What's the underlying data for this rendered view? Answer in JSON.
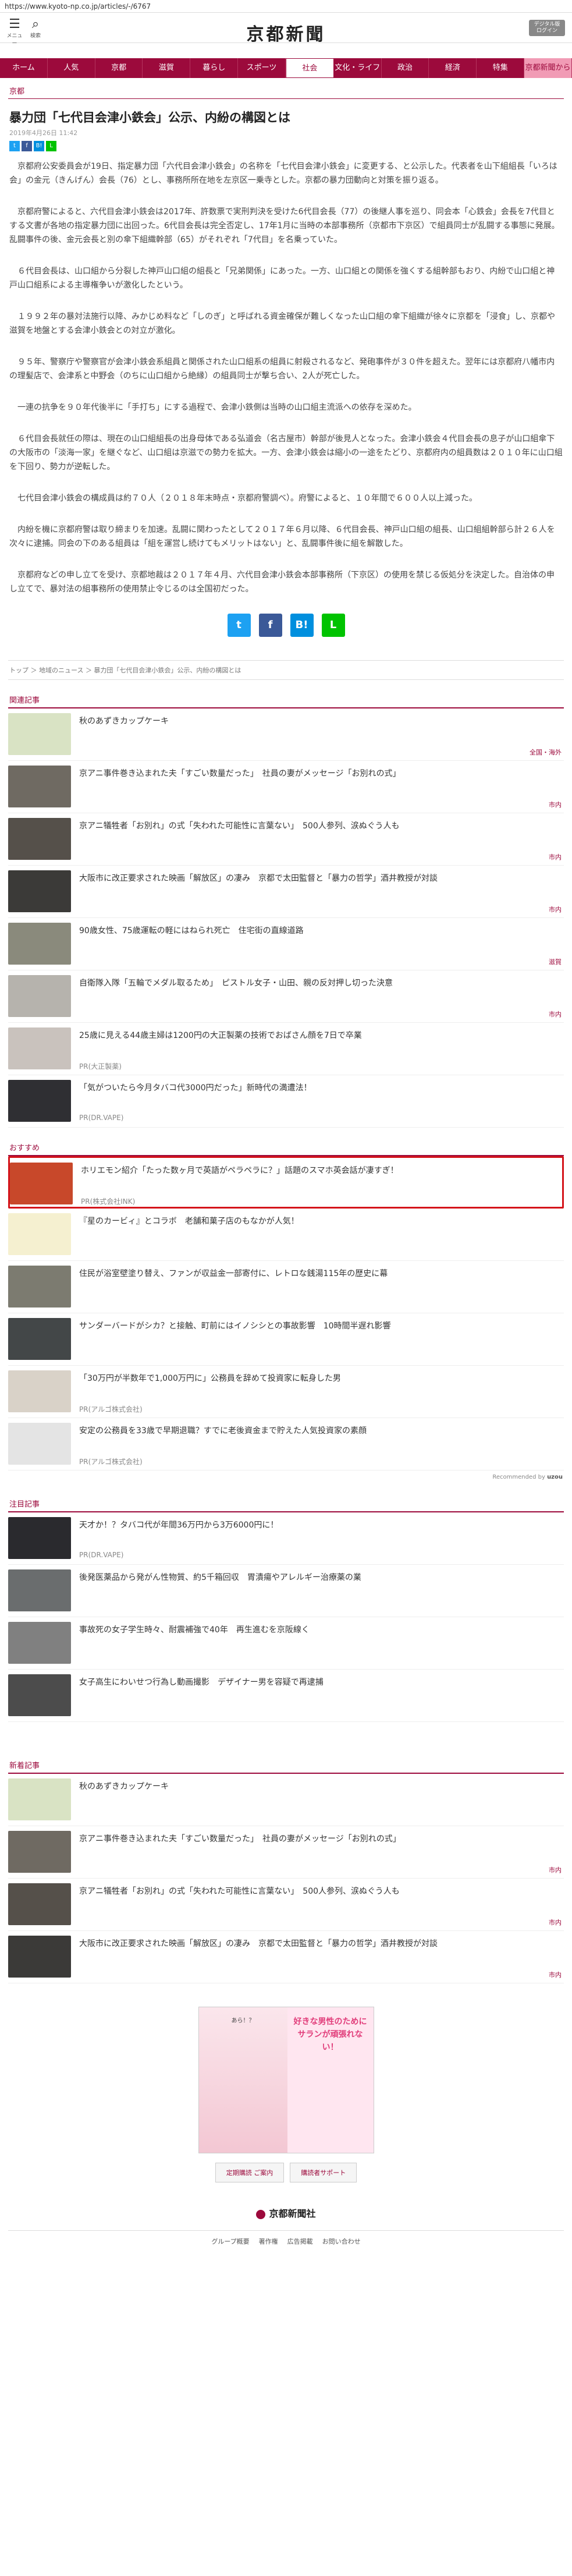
{
  "url": "https://www.kyoto-np.co.jp/articles/-/6767",
  "header": {
    "menu_label": "メニュー",
    "search_label": "検索",
    "logo": "京都新聞",
    "digital_label": "デジタル版\nログイン"
  },
  "nav": [
    "ホーム",
    "人気",
    "京都",
    "滋賀",
    "暮らし",
    "スポーツ",
    "社会",
    "文化・ライフ",
    "政治",
    "経済",
    "特集",
    "京都新聞から"
  ],
  "nav_active": "社会",
  "section": "京都",
  "article": {
    "title": "暴力団「七代目会津小鉄会」公示、内紛の構図とは",
    "date": "2019年4月26日 11:42",
    "paragraphs": [
      "京都府公安委員会が19日、指定暴力団「六代目会津小鉄会」の名称を「七代目会津小鉄会」に変更する、と公示した。代表者を山下組組長「いろは会」の金元（きんげん）会長（76）とし、事務所所在地を左京区一乗寺とした。京都の暴力団動向と対策を振り返る。",
      "京都府警によると、六代目会津小鉄会は2017年、許数票で実刑判決を受けた6代目会長（77）の後継人事を巡り、同会本「心鉄会」会長を7代目とする文書が各地の指定暴力団に出回った。6代目会長は完全否定し、17年1月に当時の本部事務所（京都市下京区）で組員同士が乱闘する事態に発展。乱闘事件の後、金元会長と別の傘下組織幹部（65）がそれぞれ「7代目」を名乗っていた。",
      "６代目会長は、山口組から分裂した神戸山口組の組長と「兄弟関係」にあった。一方、山口組との関係を強くする組幹部もおり、内紛で山口組と神戸山口組系による主導権争いが激化したという。",
      "１９９２年の暴対法施行以降、みかじめ料など「しのぎ」と呼ばれる資金確保が難しくなった山口組の傘下組織が徐々に京都を「浸食」し、京都や滋賀を地盤とする会津小鉄会との対立が激化。",
      "９５年、警察庁や警察官が会津小鉄会系組員と関係された山口組系の組員に射殺されるなど、発砲事件が３０件を超えた。翌年には京都府八幡市内の理髪店で、会津系と中野会（のちに山口組から絶縁）の組員同士が撃ち合い、2人が死亡した。",
      "一連の抗争を９０年代後半に「手打ち」にする過程で、会津小鉄側は当時の山口組主流派への依存を深めた。",
      "６代目会長就任の際は、現在の山口組組長の出身母体である弘道会（名古屋市）幹部が後見人となった。会津小鉄会４代目会長の息子が山口組傘下の大阪市の「淡海一家」を継ぐなど、山口組は京滋での勢力を拡大。一方、会津小鉄会は縮小の一途をたどり、京都府内の組員数は２０１０年に山口組を下回り、勢力が逆転した。",
      "七代目会津小鉄会の構成員は約７０人（２０１８年末時点・京都府警調べ）。府警によると、１０年間で６００人以上減った。",
      "内紛を機に京都府警は取り締まりを加速。乱闘に関わったとして２０１７年６月以降、６代目会長、神戸山口組の組長、山口組組幹部ら計２６人を次々に逮捕。同会の下のある組員は「組を運営し続けてもメリットはない」と、乱闘事件後に組を解散した。",
      "京都府などの申し立てを受け、京都地裁は２０１７年４月、六代目会津小鉄会本部事務所（下京区）の使用を禁じる仮処分を決定した。自治体の申し立てで、暴対法の組事務所の使用禁止令じるのは全国初だった。"
    ]
  },
  "share_small": [
    "Twitter",
    "Facebook",
    "Hatena",
    "LINE"
  ],
  "share_big": [
    "Twitter",
    "Facebook",
    "Hatena",
    "LINE"
  ],
  "breadcrumb": "トップ  ＞  地域のニュース  ＞  暴力団「七代目会津小鉄会」公示、内紛の構図とは",
  "related": {
    "label": "関連記事",
    "items": [
      {
        "title": "秋のあずきカップケーキ",
        "tag": "全国・海外",
        "thumb": "#d9e3c4"
      },
      {
        "title": "京アニ事件巻き込まれた夫「すごい数量だった」　社員の妻がメッセージ「お別れの式」",
        "tag": "市内",
        "thumb": "#6f6a62"
      },
      {
        "title": "京アニ犠牲者「お別れ」の式「失われた可能性に言葉ない」　500人参列、涙ぬぐう人も",
        "tag": "市内",
        "thumb": "#55504a"
      },
      {
        "title": "大阪市に改正要求された映画「解放区」の凄み　京都で太田監督と「暴力の哲学」酒井教授が対談",
        "tag": "市内",
        "thumb": "#3b3a38"
      },
      {
        "title": "90歳女性、75歳運転の軽にはねられ死亡　住宅街の直線道路",
        "tag": "滋賀",
        "thumb": "#8a8a7c"
      },
      {
        "title": "自衛隊入隊「五輪でメダル取るため」　ピストル女子・山田、親の反対押し切った決意",
        "tag": "市内",
        "thumb": "#b6b3ad"
      },
      {
        "title": "25歳に見える44歳主婦は1200円の大正製薬の技術でおばさん顔を7日で卒業",
        "pr": "PR(大正製薬)",
        "thumb": "#c9c2bd"
      },
      {
        "title": "「気がついたら今月タバコ代3000円だった」新時代の満遭法！",
        "pr": "PR(DR.VAPE)",
        "thumb": "#2f2f33"
      }
    ]
  },
  "recommend": {
    "label": "おすすめ",
    "items": [
      {
        "title": "ホリエモン紹介「たった数ヶ月で英語がペラペラに？」話題のスマホ英会話が凄すぎ！",
        "pr": "PR(株式会社INK)",
        "thumb": "#c8482a",
        "highlight": true
      },
      {
        "title": "『星のカービィ』とコラボ　老舗和菓子店のもなかが人気！",
        "thumb": "#f5f0d0"
      },
      {
        "title": "住民が浴室壁塗り替え、ファンが収益金一部寄付に、レトロな銭湯115年の歴史に幕",
        "thumb": "#7c7b70"
      },
      {
        "title": "サンダーバードがシカ？と接触、町前にはイノシシとの事故影響　10時間半遅れ影響",
        "thumb": "#434748"
      },
      {
        "title": "「30万円が半数年で1,000万円に」公務員を辞めて投資家に転身した男",
        "pr": "PR(アルゴ株式会社)",
        "thumb": "#d9d2c8"
      },
      {
        "title": "安定の公務員を33歳で早期退職？すでに老後資金まで貯えた人気投資家の素顔",
        "pr": "PR(アルゴ株式会社)",
        "thumb": "#e4e4e4"
      }
    ],
    "footer": "Recommended by",
    "footer_brand": "uzou"
  },
  "attention": {
    "label": "注目記事",
    "items": [
      {
        "title": "天才か！？タバコ代が年間36万円から3万6000円に！",
        "pr": "PR(DR.VAPE)",
        "thumb": "#2a2a2e"
      },
      {
        "title": "後発医薬品から発がん性物質、約5千箱回収　胃潰瘍やアレルギー治療薬の業",
        "thumb": "#6a6d6e"
      },
      {
        "title": "事故死の女子学生時々、耐震補強で40年　再生進むを京阪線く",
        "thumb": "#808080"
      },
      {
        "title": "女子高生にわいせつ行為し動画撮影　デザイナー男を容疑で再逮捕",
        "thumb": "#4c4c4c"
      }
    ]
  },
  "newest": {
    "label": "新着記事",
    "items": [
      {
        "title": "秋のあずきカップケーキ",
        "thumb": "#d9e3c4"
      },
      {
        "title": "京アニ事件巻き込まれた夫「すごい数量だった」　社員の妻がメッセージ「お別れの式」",
        "tag": "市内",
        "thumb": "#6f6a62"
      },
      {
        "title": "京アニ犠牲者「お別れ」の式「失われた可能性に言葉ない」　500人参列、涙ぬぐう人も",
        "tag": "市内",
        "thumb": "#55504a"
      },
      {
        "title": "大阪市に改正要求された映画「解放区」の凄み　京都で太田監督と「暴力の哲学」酒井教授が対談",
        "tag": "市内",
        "thumb": "#3b3a38"
      }
    ]
  },
  "ad": {
    "left_text": "あら！？",
    "right_text": "好きな男性のために サランが頑張れない！"
  },
  "buttons": [
    "定期購読 ご案内",
    "購読者サポート"
  ],
  "footer": {
    "logo": "京都新聞社",
    "links": [
      "グループ概要",
      "著作権",
      "広告掲載",
      "お問い合わせ"
    ]
  },
  "colors": {
    "brand": "#9c0a3c",
    "highlight": "#d4141a"
  }
}
